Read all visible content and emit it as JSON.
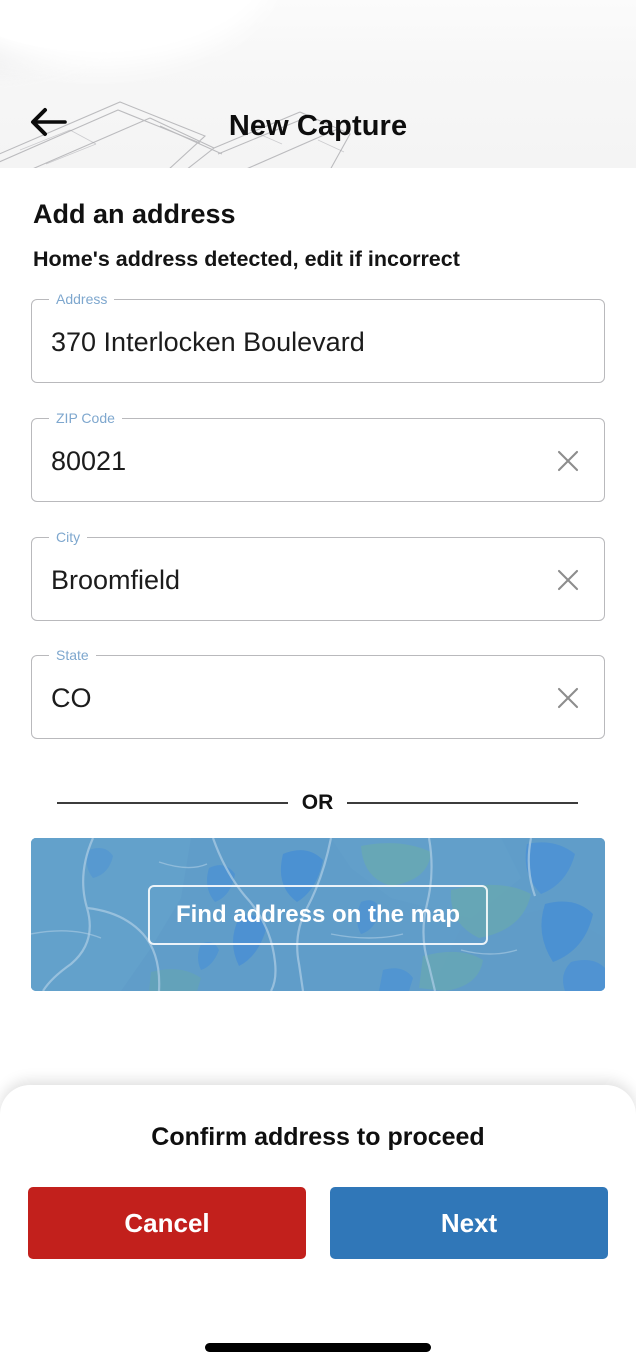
{
  "header": {
    "back_icon": "arrow-left-icon",
    "title": "New Capture"
  },
  "main": {
    "title": "Add an address",
    "subtitle": "Home's address detected, edit if incorrect",
    "fields": [
      {
        "label": "Address",
        "value": "370 Interlocken Boulevard",
        "clearable": false,
        "clear_icon": "close-icon"
      },
      {
        "label": "ZIP Code",
        "value": "80021",
        "clearable": true,
        "clear_icon": "close-icon"
      },
      {
        "label": "City",
        "value": "Broomfield",
        "clearable": true,
        "clear_icon": "close-icon"
      },
      {
        "label": "State",
        "value": "CO",
        "clearable": true,
        "clear_icon": "close-icon"
      }
    ],
    "divider_label": "OR",
    "map": {
      "button_label": "Find address on the map",
      "icon": "map-thumbnail"
    }
  },
  "bottom_sheet": {
    "prompt": "Confirm address to proceed",
    "cancel_label": "Cancel",
    "next_label": "Next"
  },
  "colors": {
    "cancel": "#c2201c",
    "next": "#3077b8",
    "field_label": "#7ea7ce",
    "field_border": "#b9b9bc",
    "map_tint": "#5f9ecb"
  }
}
